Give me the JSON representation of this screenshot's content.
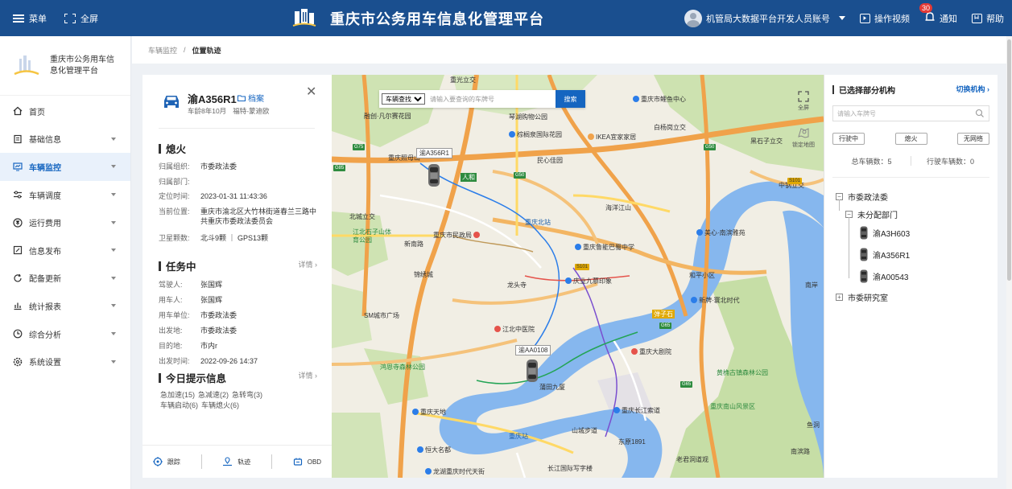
{
  "topbar": {
    "menu_label": "菜单",
    "fullscreen_label": "全屏",
    "title": "重庆市公务用车信息化管理平台",
    "user": "机管局大数据平台开发人员账号",
    "video_label": "操作视频",
    "notice_label": "通知",
    "notice_count": "30",
    "help_label": "帮助"
  },
  "sidebar": {
    "brand": "重庆市公务用车信息化管理平台",
    "items": [
      {
        "label": "首页",
        "icon": "home-icon"
      },
      {
        "label": "基础信息",
        "icon": "document-icon"
      },
      {
        "label": "车辆监控",
        "icon": "monitor-icon"
      },
      {
        "label": "车辆调度",
        "icon": "schedule-icon"
      },
      {
        "label": "运行费用",
        "icon": "money-icon"
      },
      {
        "label": "信息发布",
        "icon": "edit-icon"
      },
      {
        "label": "配备更新",
        "icon": "refresh-icon"
      },
      {
        "label": "统计报表",
        "icon": "bar-chart-icon"
      },
      {
        "label": "综合分析",
        "icon": "analysis-icon"
      },
      {
        "label": "系统设置",
        "icon": "settings-icon"
      }
    ]
  },
  "breadcrumb": {
    "parent": "车辆监控",
    "sep": "/",
    "current": "位置轨迹"
  },
  "vehicle": {
    "plate": "渝A356R1",
    "archive_label": "档案",
    "age": "车龄8年10月",
    "model": "福特-蒙迪欧",
    "status_title": "熄火",
    "fields": [
      {
        "k": "归属组织:",
        "v": "市委政法委"
      },
      {
        "k": "归属部门:",
        "v": ""
      },
      {
        "k": "定位时间:",
        "v": "2023-01-31 11:43:36"
      },
      {
        "k": "当前位置:",
        "v": "重庆市渝北区大竹林街道春兰三路中共重庆市委政法委员会"
      },
      {
        "k": "卫星颗数:",
        "v": "北斗9颗 ｜ GPS13颗"
      }
    ],
    "task_title": "任务中",
    "detail_label": "详情",
    "task_fields": [
      {
        "k": "驾驶人:",
        "v": "张国辉"
      },
      {
        "k": "用车人:",
        "v": "张国辉"
      },
      {
        "k": "用车单位:",
        "v": "市委政法委"
      },
      {
        "k": "出发地:",
        "v": "市委政法委"
      },
      {
        "k": "目的地:",
        "v": "市内r"
      },
      {
        "k": "出发时间:",
        "v": "2022-09-26 14:37"
      }
    ],
    "tips_title": "今日提示信息",
    "tips": [
      "急加速(15)",
      "急减速(2)",
      "急转弯(3)",
      "车辆启动(6)",
      "车辆熄火(6)"
    ],
    "actions": [
      "跟踪",
      "轨迹",
      "OBD"
    ]
  },
  "map": {
    "search_type": "车辆查找",
    "search_placeholder": "请输入要查询的车牌号",
    "search_button": "搜索",
    "fullscreen": "全屏",
    "lock_view": "锁定地图",
    "vehicles": [
      "渝A356R1",
      "渝AA0108"
    ],
    "labels": {
      "l1": "重光立交",
      "l2": "重庆市鲤鱼中心",
      "l3": "融创·凡尔赛花园",
      "l4": "琴湖购物公园",
      "l5": "棕榈泉国际花园",
      "l6": "IKEA宜家家居",
      "l7": "白杨岗立交",
      "l8": "重庆照母山",
      "l9": "民心佳园",
      "l10": "人和",
      "l11": "海洋江山",
      "l12": "重庆北站",
      "l13": "江北石子山体育公园",
      "l14": "重庆市民政局",
      "l15": "重庆鲁能巴蜀中学",
      "l16": "美心·南滨雅苑",
      "l17": "和平小区",
      "l18": "锦绣城",
      "l19": "龙头寺",
      "l20": "庆业九慕印象",
      "l21": "新牌·寰北时代",
      "l22": "江北中医院",
      "l23": "重庆大剧院",
      "l24": "鸿恩寺森林公园",
      "l25": "蒲田九厦",
      "l26": "重庆天地",
      "l27": "重庆长江索道",
      "l28": "重庆南山风景区",
      "l29": "重庆站",
      "l30": "山城步道",
      "l31": "东原1891",
      "l32": "恒大名都",
      "l33": "龙湖重庆时代天街",
      "l34": "长江国际写字楼",
      "l35": "老君洞道观",
      "l36": "黑石子立交",
      "l37": "北城立交",
      "l38": "弹子石",
      "l39": "南岸",
      "l40": "新南路",
      "l41": "鱼洞",
      "l42": "南滨路",
      "l43": "SM城市广场",
      "l44": "黄桷古镇森林公园",
      "l45": "中钢立交"
    }
  },
  "rpanel": {
    "title": "已选择部分机构",
    "switch_label": "切换机构",
    "search_placeholder": "请输入车牌号",
    "filters": [
      "行驶中",
      "熄火",
      "无网络"
    ],
    "total": "总车辆数：5",
    "driving": "行驶车辆数：0",
    "tree": {
      "root": "市委政法委",
      "child": "未分配部门",
      "cars": [
        "渝A3H603",
        "渝A356R1",
        "渝A00543"
      ],
      "root2": "市委研究室"
    }
  }
}
